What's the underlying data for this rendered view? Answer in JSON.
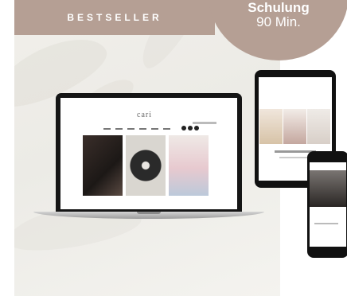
{
  "badge": {
    "label": "BESTSELLER"
  },
  "corner": {
    "type_label": "Schulung",
    "duration": "90 Min."
  },
  "mockup": {
    "brand_logo": "cari"
  }
}
